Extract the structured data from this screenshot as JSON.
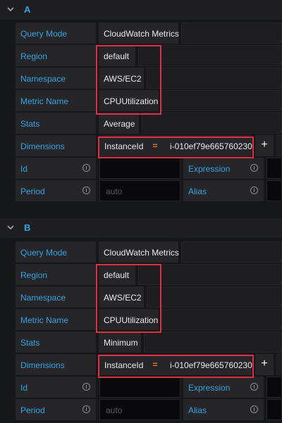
{
  "colors": {
    "background": "#161719",
    "label_text": "#33a2e5",
    "highlight": "#e02f44",
    "operator": "#eb7b18"
  },
  "queries": [
    {
      "name": "A",
      "query_mode": {
        "label": "Query Mode",
        "value": "CloudWatch Metrics"
      },
      "region": {
        "label": "Region",
        "value": "default"
      },
      "namespace": {
        "label": "Namespace",
        "value": "AWS/EC2"
      },
      "metric_name": {
        "label": "Metric Name",
        "value": "CPUUtilization"
      },
      "stats": {
        "label": "Stats",
        "value": "Average"
      },
      "dimensions": {
        "label": "Dimensions",
        "key": "InstanceId",
        "operator": "=",
        "value": "i-010ef79e665760230",
        "add": "+"
      },
      "id": {
        "label": "Id",
        "value": ""
      },
      "expression": {
        "label": "Expression",
        "value": ""
      },
      "period": {
        "label": "Period",
        "placeholder": "auto"
      },
      "alias": {
        "label": "Alias",
        "value": ""
      }
    },
    {
      "name": "B",
      "query_mode": {
        "label": "Query Mode",
        "value": "CloudWatch Metrics"
      },
      "region": {
        "label": "Region",
        "value": "default"
      },
      "namespace": {
        "label": "Namespace",
        "value": "AWS/EC2"
      },
      "metric_name": {
        "label": "Metric Name",
        "value": "CPUUtilization"
      },
      "stats": {
        "label": "Stats",
        "value": "Minimum"
      },
      "dimensions": {
        "label": "Dimensions",
        "key": "InstanceId",
        "operator": "=",
        "value": "i-010ef79e665760230",
        "add": "+"
      },
      "id": {
        "label": "Id",
        "value": ""
      },
      "expression": {
        "label": "Expression",
        "value": ""
      },
      "period": {
        "label": "Period",
        "placeholder": "auto"
      },
      "alias": {
        "label": "Alias",
        "value": ""
      }
    }
  ]
}
